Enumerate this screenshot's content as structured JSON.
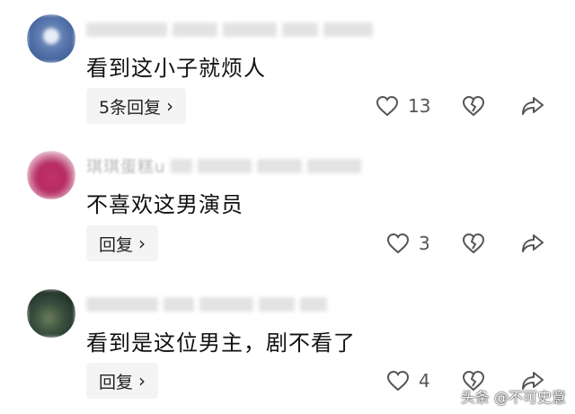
{
  "comments": [
    {
      "text": "看到这小子就烦人",
      "reply_label": "5条回复",
      "like_count": "13"
    },
    {
      "username_visible": "琪琪蛋糕u",
      "text": "不喜欢这男演员",
      "reply_label": "回复",
      "like_count": "3"
    },
    {
      "text": "看到是这位男主，剧不看了",
      "reply_label": "回复",
      "like_count": "4"
    }
  ],
  "icons": {
    "like": "heart-outline-icon",
    "dislike": "broken-heart-icon",
    "share": "share-arrow-icon",
    "reply_more": "chevron-right-icon"
  },
  "watermark": "头条 @不可史意",
  "colors": {
    "text": "#111111",
    "muted": "#555555",
    "reply_bg": "#f4f4f4",
    "avatar1": "#5b7bb0",
    "avatar2": "#c2346a",
    "avatar3": "#2e4a3a"
  }
}
